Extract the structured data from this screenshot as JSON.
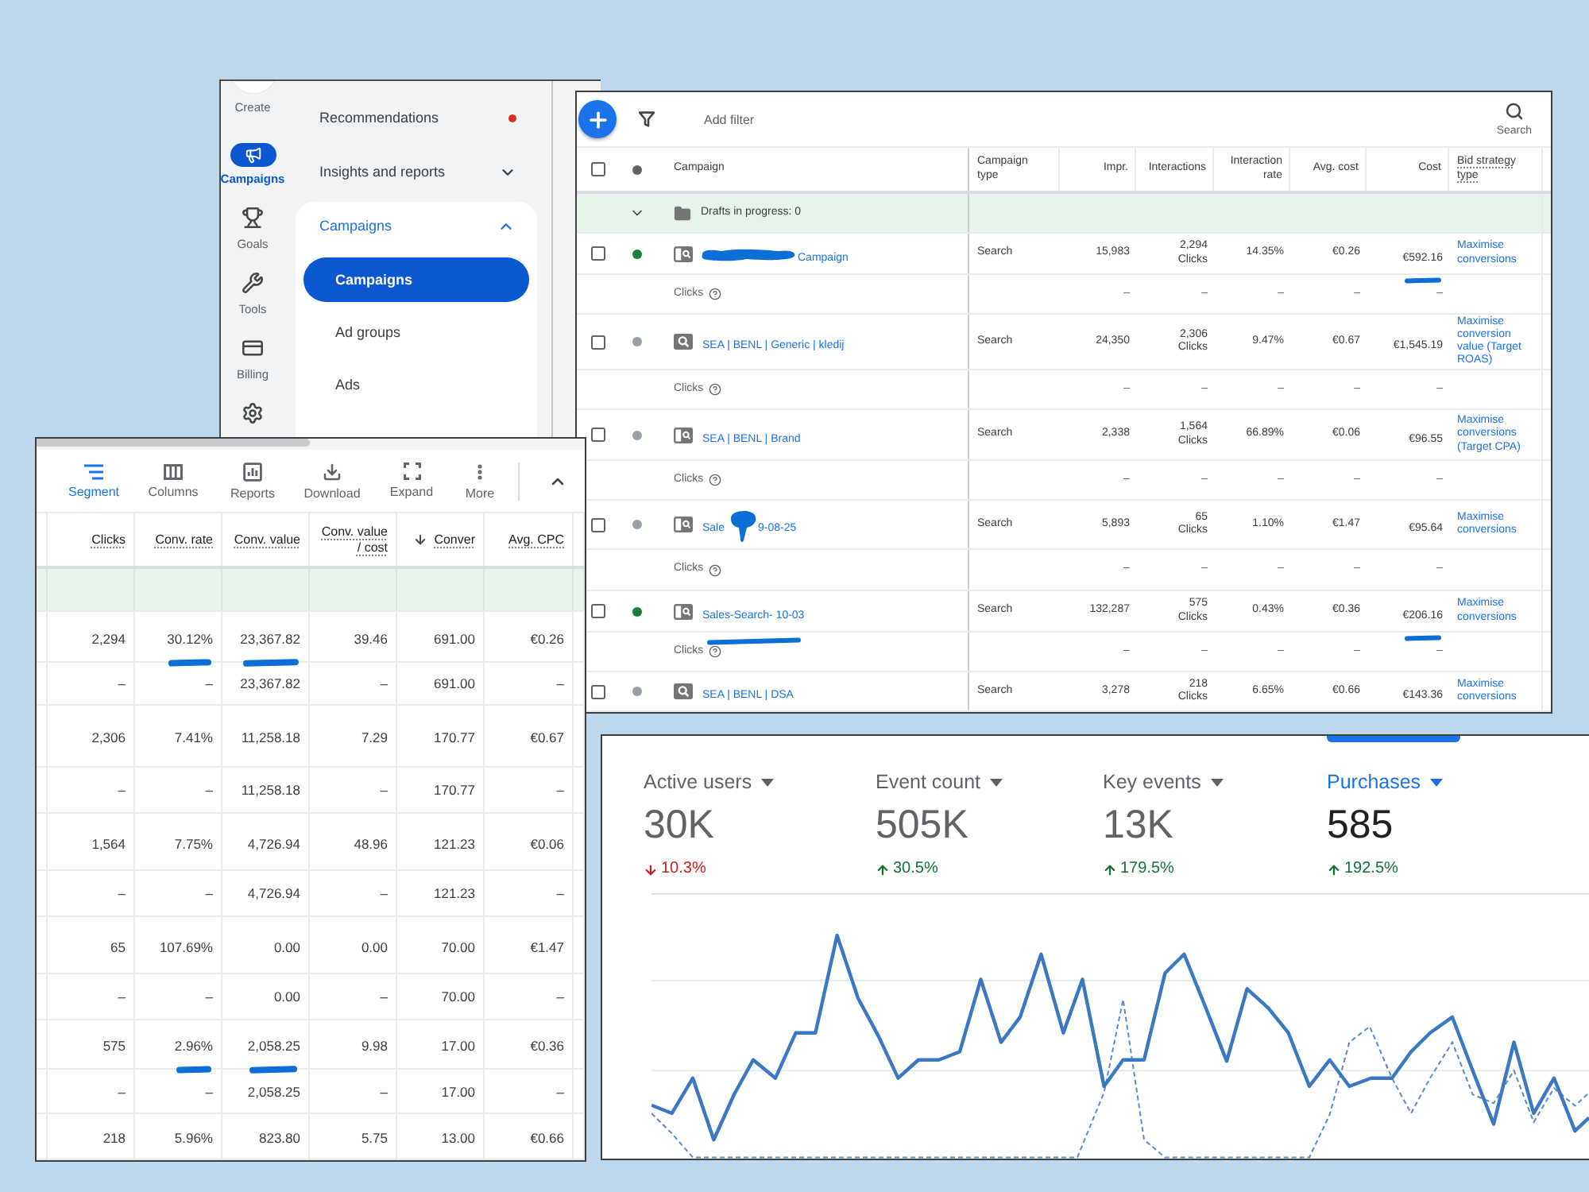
{
  "sidebar": {
    "rail": [
      {
        "kind": "create",
        "label": "Create",
        "selected": false
      },
      {
        "kind": "campaigns",
        "label": "Campaigns",
        "selected": true
      },
      {
        "kind": "goals",
        "label": "Goals",
        "selected": false
      },
      {
        "kind": "tools",
        "label": "Tools",
        "selected": false
      },
      {
        "kind": "billing",
        "label": "Billing",
        "selected": false
      },
      {
        "kind": "admin",
        "selected": false
      }
    ],
    "nav": [
      {
        "kind": "link",
        "label": "Recommendations",
        "alert": true
      },
      {
        "kind": "group",
        "label": "Insights and reports",
        "expanded": false
      },
      {
        "kind": "group",
        "label": "Campaigns",
        "expanded": true,
        "children": [
          {
            "label": "Campaigns",
            "selected": true
          },
          {
            "label": "Ad groups",
            "selected": false
          },
          {
            "label": "Ads",
            "selected": false
          }
        ]
      }
    ]
  },
  "campaign_table": {
    "toolbar": {
      "filter_label": "Add filter",
      "search_label": "Search"
    },
    "header_checked": false,
    "columns": [
      "Campaign",
      "Campaign type",
      "Impr.",
      "Interactions",
      "Interaction rate",
      "Avg. cost",
      "Cost",
      "Bid strategy type"
    ],
    "drafts": "Drafts in progress: 0",
    "rows": [
      {
        "checked": false,
        "color": "#188038",
        "filled_icon": false,
        "name_parts": [
          {
            "kind": "scribble"
          },
          {
            "kind": "text",
            "text": "Campaign"
          }
        ],
        "name_underlined": false,
        "type": "Search",
        "impr": "15,983",
        "interactions": "2,294",
        "interactions_unit": "Clicks",
        "interaction_rate": "14.35%",
        "avg_cost": "€0.26",
        "cost": "€592.16",
        "cost_underlined": true,
        "bid_strategy": "Maximise conversions",
        "sub_label": "Clicks",
        "sub_values": [
          "–",
          "–",
          "–",
          "–",
          "–"
        ]
      },
      {
        "checked": false,
        "color": "#9aa0a6",
        "filled_icon": true,
        "name_parts": [
          {
            "kind": "text",
            "text": "SEA | BENL | Generic | kledij"
          }
        ],
        "name_underlined": false,
        "type": "Search",
        "impr": "24,350",
        "interactions": "2,306",
        "interactions_unit": "Clicks",
        "interaction_rate": "9.47%",
        "avg_cost": "€0.67",
        "cost": "€1,545.19",
        "cost_underlined": false,
        "bid_strategy": "Maximise conversion value (Target ROAS)",
        "sub_label": "Clicks",
        "sub_values": [
          "–",
          "–",
          "–",
          "–",
          "–"
        ]
      },
      {
        "checked": false,
        "color": "#9aa0a6",
        "filled_icon": false,
        "name_parts": [
          {
            "kind": "text",
            "text": "SEA | BENL | Brand"
          }
        ],
        "name_underlined": false,
        "type": "Search",
        "impr": "2,338",
        "interactions": "1,564",
        "interactions_unit": "Clicks",
        "interaction_rate": "66.89%",
        "avg_cost": "€0.06",
        "cost": "€96.55",
        "cost_underlined": false,
        "bid_strategy": "Maximise conversions (Target CPA)",
        "sub_label": "Clicks",
        "sub_values": [
          "–",
          "–",
          "–",
          "–",
          "–"
        ]
      },
      {
        "checked": false,
        "color": "#9aa0a6",
        "filled_icon": false,
        "name_parts": [
          {
            "kind": "text",
            "text": "Sale"
          },
          {
            "kind": "blot"
          },
          {
            "kind": "text",
            "text": "9-08-25"
          }
        ],
        "name_underlined": false,
        "type": "Search",
        "impr": "5,893",
        "interactions": "65",
        "interactions_unit": "Clicks",
        "interaction_rate": "1.10%",
        "avg_cost": "€1.47",
        "cost": "€95.64",
        "cost_underlined": false,
        "bid_strategy": "Maximise conversions",
        "sub_label": "Clicks",
        "sub_values": [
          "–",
          "–",
          "–",
          "–",
          "–"
        ]
      },
      {
        "checked": false,
        "color": "#188038",
        "filled_icon": false,
        "name_parts": [
          {
            "kind": "text",
            "text": "Sales-Search- 10-03"
          }
        ],
        "name_underlined": true,
        "type": "Search",
        "impr": "132,287",
        "interactions": "575",
        "interactions_unit": "Clicks",
        "interaction_rate": "0.43%",
        "avg_cost": "€0.36",
        "cost": "€206.16",
        "cost_underlined": true,
        "bid_strategy": "Maximise conversions",
        "sub_label": "Clicks",
        "sub_values": [
          "–",
          "–",
          "–",
          "–",
          "–"
        ]
      },
      {
        "checked": false,
        "color": "#9aa0a6",
        "filled_icon": true,
        "name_parts": [
          {
            "kind": "text",
            "text": "SEA | BENL | DSA"
          }
        ],
        "name_underlined": false,
        "type": "Search",
        "impr": "3,278",
        "interactions": "218",
        "interactions_unit": "Clicks",
        "interaction_rate": "6.65%",
        "avg_cost": "€0.66",
        "cost": "€143.36",
        "cost_underlined": false,
        "bid_strategy": "Maximise conversions"
      }
    ]
  },
  "metrics_table": {
    "toolbar": [
      {
        "kind": "segment",
        "label": "Segment",
        "selected": true
      },
      {
        "kind": "columns",
        "label": "Columns",
        "selected": false
      },
      {
        "kind": "reports",
        "label": "Reports",
        "selected": false
      },
      {
        "kind": "download",
        "label": "Download",
        "selected": false
      },
      {
        "kind": "expand",
        "label": "Expand",
        "selected": false
      },
      {
        "kind": "more",
        "label": "More",
        "selected": false
      }
    ],
    "columns": [
      {
        "label": "Clicks",
        "sorted": false
      },
      {
        "label": "Conv. rate",
        "sorted": false
      },
      {
        "label": "Conv. value",
        "sorted": false
      },
      {
        "label": "Conv. value / cost",
        "sorted": false
      },
      {
        "label": "Conver",
        "sorted": true
      },
      {
        "label": "Avg. CPC",
        "sorted": false
      }
    ],
    "rows": [
      {
        "cells": [
          "2,294",
          "30.12%",
          "23,367.82",
          "39.46",
          "691.00",
          "€0.26"
        ],
        "underlined": [
          false,
          true,
          true,
          false,
          false,
          false
        ],
        "sub_cells": [
          "–",
          "–",
          "23,367.82",
          "–",
          "691.00",
          "–"
        ]
      },
      {
        "cells": [
          "2,306",
          "7.41%",
          "11,258.18",
          "7.29",
          "170.77",
          "€0.67"
        ],
        "underlined": [
          false,
          false,
          false,
          false,
          false,
          false
        ],
        "sub_cells": [
          "–",
          "–",
          "11,258.18",
          "–",
          "170.77",
          "–"
        ]
      },
      {
        "cells": [
          "1,564",
          "7.75%",
          "4,726.94",
          "48.96",
          "121.23",
          "€0.06"
        ],
        "underlined": [
          false,
          false,
          false,
          false,
          false,
          false
        ],
        "sub_cells": [
          "–",
          "–",
          "4,726.94",
          "–",
          "121.23",
          "–"
        ]
      },
      {
        "cells": [
          "65",
          "107.69%",
          "0.00",
          "0.00",
          "70.00",
          "€1.47"
        ],
        "underlined": [
          false,
          false,
          false,
          false,
          false,
          false
        ],
        "sub_cells": [
          "–",
          "–",
          "0.00",
          "–",
          "70.00",
          "–"
        ]
      },
      {
        "cells": [
          "575",
          "2.96%",
          "2,058.25",
          "9.98",
          "17.00",
          "€0.36"
        ],
        "underlined": [
          false,
          true,
          true,
          false,
          false,
          false
        ],
        "sub_cells": [
          "–",
          "–",
          "2,058.25",
          "–",
          "17.00",
          "–"
        ]
      },
      {
        "cells": [
          "218",
          "5.96%",
          "823.80",
          "5.75",
          "13.00",
          "€0.66"
        ],
        "underlined": [
          false,
          false,
          false,
          false,
          false,
          false
        ]
      }
    ]
  },
  "analytics": {
    "metrics": [
      {
        "label": "Active users",
        "value": "30K",
        "change": "10.3%",
        "increase": false,
        "selected": false
      },
      {
        "label": "Event count",
        "value": "505K",
        "change": "30.5%",
        "increase": true,
        "selected": false
      },
      {
        "label": "Key events",
        "value": "13K",
        "change": "179.5%",
        "increase": true,
        "selected": false
      },
      {
        "label": "Purchases",
        "value": "585",
        "change": "192.5%",
        "increase": true,
        "selected": true
      }
    ]
  }
}
